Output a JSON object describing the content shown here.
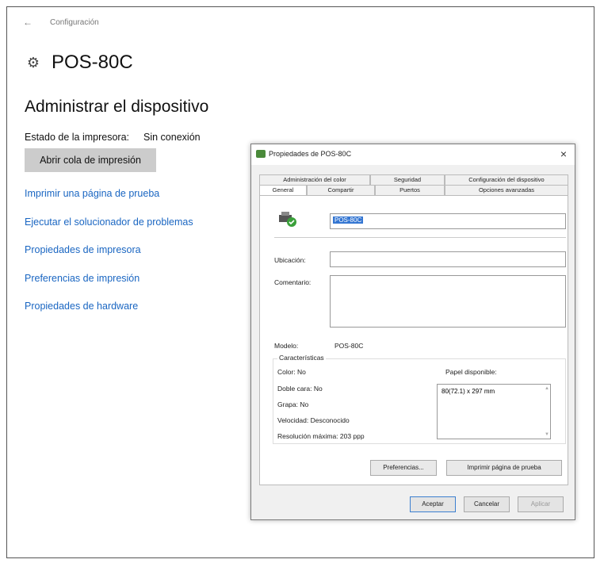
{
  "topbar": {
    "back": "←",
    "title": "Configuración"
  },
  "page": {
    "title": "POS-80C",
    "section": "Administrar el dispositivo"
  },
  "status": {
    "label": "Estado de la impresora:",
    "value": "Sin conexión"
  },
  "queue_button": "Abrir cola de impresión",
  "links": [
    "Imprimir una página de prueba",
    "Ejecutar el solucionador de problemas",
    "Propiedades de impresora",
    "Preferencias de impresión",
    "Propiedades de hardware"
  ],
  "dialog": {
    "title": "Propiedades de POS-80C",
    "close": "×",
    "tabs_row1": [
      "Administración del color",
      "Seguridad",
      "Configuración del dispositivo"
    ],
    "tabs_row2": [
      "General",
      "Compartir",
      "Puertos",
      "Opciones avanzadas"
    ],
    "name_value": "POS-80C",
    "location_label": "Ubicación:",
    "location_value": "",
    "comment_label": "Comentario:",
    "comment_value": "",
    "model_label": "Modelo:",
    "model_value": "POS-80C",
    "features": {
      "title": "Características",
      "color": "Color: No",
      "duplex": "Doble cara: No",
      "staple": "Grapa: No",
      "speed": "Velocidad: Desconocido",
      "resolution": "Resolución máxima: 203 ppp",
      "paper_label": "Papel disponible:",
      "paper_items": [
        "80(72.1) x 297 mm"
      ]
    },
    "buttons": {
      "preferences": "Preferencias...",
      "test_page": "Imprimir página de prueba",
      "ok": "Aceptar",
      "cancel": "Cancelar",
      "apply": "Aplicar"
    }
  }
}
